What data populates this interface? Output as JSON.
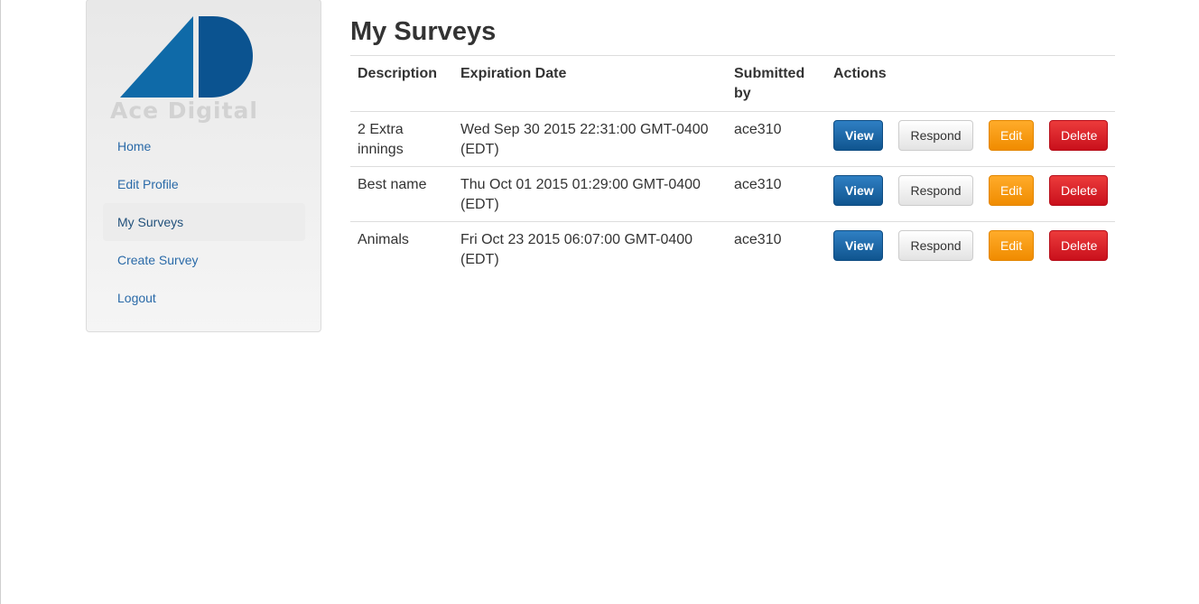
{
  "sidebar": {
    "logo_text": "Ace Digital",
    "nav": [
      {
        "label": "Home",
        "active": false
      },
      {
        "label": "Edit Profile",
        "active": false
      },
      {
        "label": "My Surveys",
        "active": true
      },
      {
        "label": "Create Survey",
        "active": false
      },
      {
        "label": "Logout",
        "active": false
      }
    ]
  },
  "main": {
    "title": "My Surveys",
    "columns": [
      "Description",
      "Expiration Date",
      "Submitted by",
      "Actions"
    ],
    "rows": [
      {
        "description": "2 Extra innings",
        "expiration": "Wed Sep 30 2015 22:31:00 GMT-0400 (EDT)",
        "submitted_by": "ace310"
      },
      {
        "description": "Best name",
        "expiration": "Thu Oct 01 2015 01:29:00 GMT-0400 (EDT)",
        "submitted_by": "ace310"
      },
      {
        "description": "Animals",
        "expiration": "Fri Oct 23 2015 06:07:00 GMT-0400 (EDT)",
        "submitted_by": "ace310"
      }
    ],
    "buttons": {
      "view": "View",
      "respond": "Respond",
      "edit": "Edit",
      "delete": "Delete"
    }
  },
  "colors": {
    "logo_left": "#0f6aa8",
    "logo_right": "#0b5390",
    "link": "#2a6aa8",
    "view": "#1a65a8",
    "edit": "#f7960f",
    "delete": "#dc1f2a"
  }
}
